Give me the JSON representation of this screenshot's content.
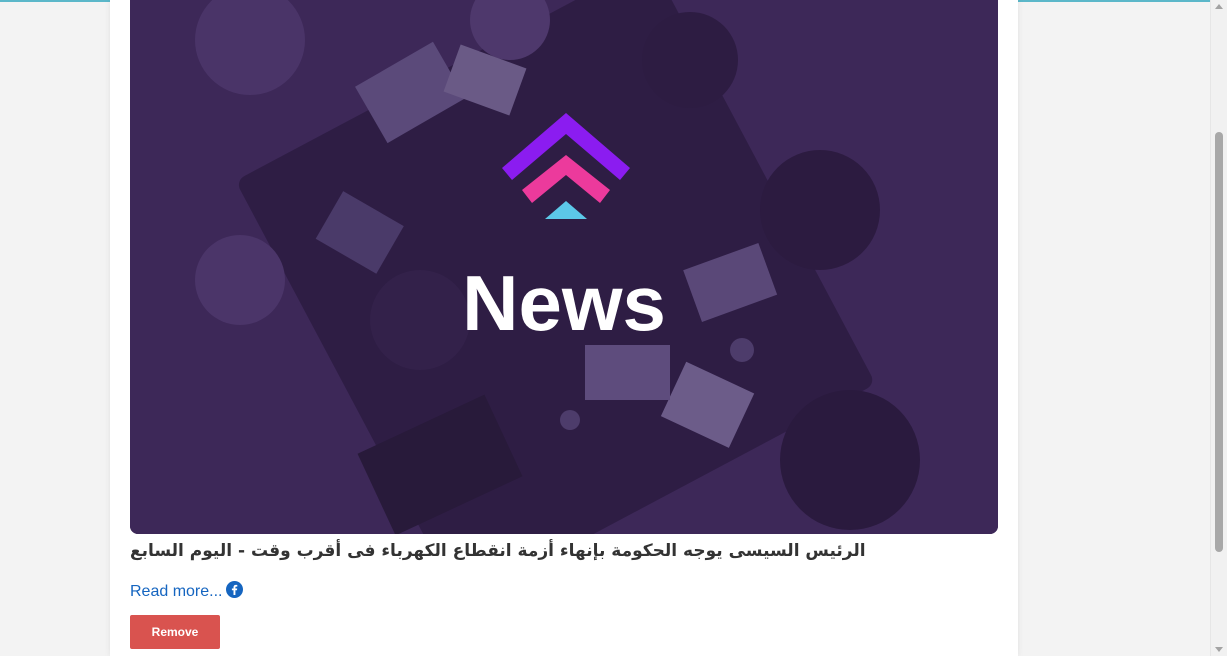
{
  "article": {
    "image_alt": "News",
    "image_caption": "News",
    "headline": "الرئيس السيسى يوجه الحكومة بإنهاء أزمة انقطاع الكهرباء فى أقرب وقت - اليوم السابع",
    "read_more_label": "Read more...",
    "share_icon": "facebook-icon",
    "remove_label": "Remove"
  },
  "colors": {
    "accent_line": "#5bb7c9",
    "remove_button": "#d9534f",
    "link": "#1565c0",
    "hero_overlay": "#3f2a5a",
    "logo_purple": "#8b1cf0",
    "logo_pink": "#ec3a9c",
    "logo_cyan": "#5cc8e8"
  }
}
